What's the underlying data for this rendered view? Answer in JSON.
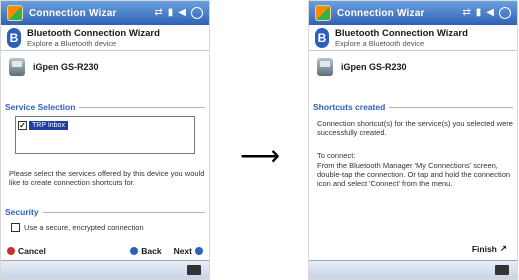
{
  "left_screen": {
    "title": "Connection Wizar",
    "wizard_title": "Bluetooth Connection Wizard",
    "wizard_subtitle": "Explore a Bluetooth device",
    "device_name": "iGpen GS-R230",
    "service_section": "Service Selection",
    "service_item": "TRP Inbox",
    "instructions": "Please select the services offered by this device you would like to create connection shortcuts for.",
    "security_section": "Security",
    "secure_label": "Use a secure, encrypted connection",
    "nav": {
      "cancel": "Cancel",
      "back": "Back",
      "next": "Next"
    }
  },
  "right_screen": {
    "title": "Connection Wizar",
    "wizard_title": "Bluetooth Connection Wizard",
    "wizard_subtitle": "Explore a Bluetooth device",
    "device_name": "iGpen GS-R230",
    "shortcuts_section": "Shortcuts created",
    "created_text": "Connection shortcut(s) for the service(s) you selected were successfully created.",
    "to_connect": "To connect:",
    "connect_text": "From the Bluetooth Manager 'My Connections' screen, double-tap the connection. Or tap and hold the connection icon and select 'Connect' from the menu.",
    "finish": "Finish"
  },
  "transition": {
    "arrow": "⟶"
  }
}
